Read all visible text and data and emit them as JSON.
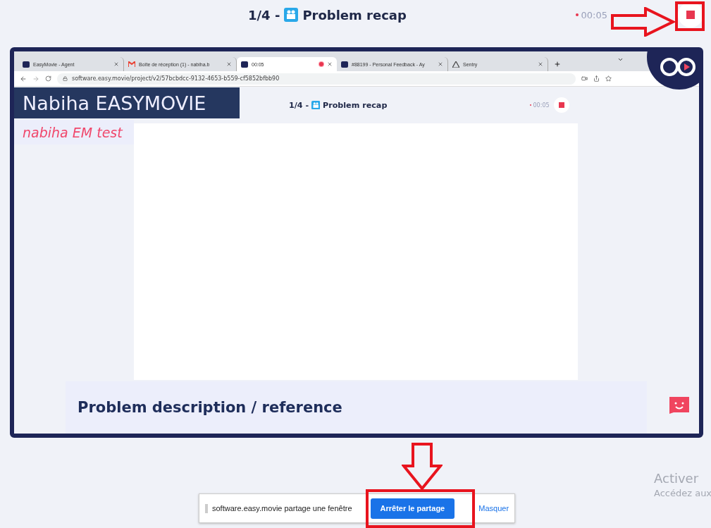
{
  "header": {
    "step": "1/4 -",
    "title": "Problem recap",
    "timer": "00:05",
    "recording": true
  },
  "shared_screen": {
    "tabs": [
      {
        "label": "EasyMovie - Agent",
        "selected": false,
        "recording": false
      },
      {
        "label": "Boîte de réception (1) - nabiha.b",
        "selected": false,
        "recording": false
      },
      {
        "label": "00:05",
        "selected": true,
        "recording": true
      },
      {
        "label": "#88199 - Personal Feedback - Ay",
        "selected": false,
        "recording": false
      },
      {
        "label": "Sentry",
        "selected": false,
        "recording": false
      }
    ],
    "url": "software.easy.movie/project/v2/57bcbdcc-9132-4653-b559-cf5852bfbb90",
    "name_banner": "Nabiha EASYMOVIE",
    "subtitle": "nabiha EM test",
    "inner_header": {
      "step": "1/4 -",
      "title": "Problem recap",
      "timer": "00:05",
      "recording": true
    },
    "panel_title": "Problem description / reference"
  },
  "share_bar": {
    "message": "software.easy.movie partage une fenêtre",
    "stop_button": "Arrêter le partage",
    "hide_link": "Masquer"
  },
  "os_notice": [
    "Activer",
    "Accédez aux"
  ]
}
